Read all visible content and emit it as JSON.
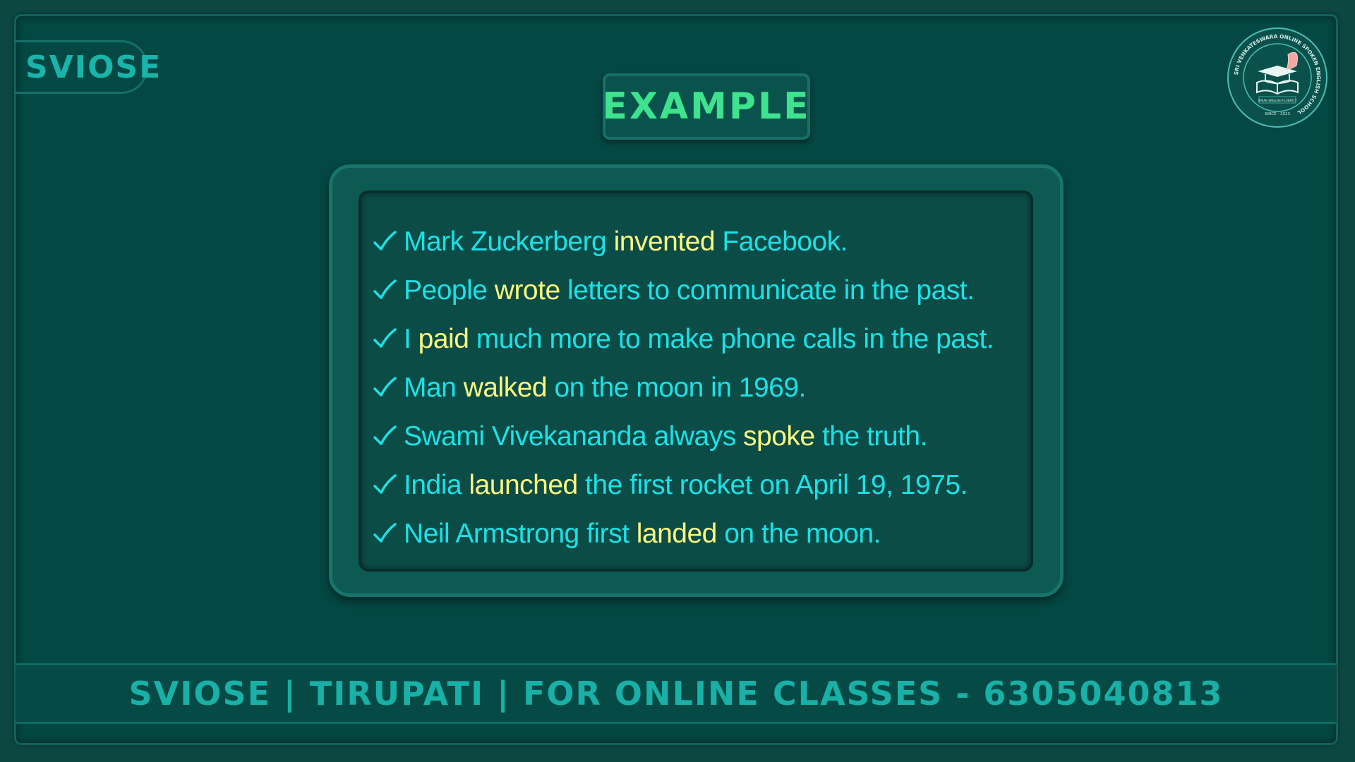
{
  "brand": {
    "tag": "SVIOSE"
  },
  "title": "EXAMPLE",
  "logo": {
    "ring_text": "SRI VENKATESWARA ONLINE SPOKEN ENGLISH SCHOOL",
    "motto": "SPEAK ENGLISH FLUENTLY",
    "since": "SINCE - 2023",
    "icon": "book-quill-cap-icon"
  },
  "examples": [
    {
      "before": "Mark Zuckerberg ",
      "verb": "invented",
      "after": " Facebook."
    },
    {
      "before": "People ",
      "verb": "wrote",
      "after": " letters to communicate in the past."
    },
    {
      "before": "I ",
      "verb": "paid",
      "after": " much more to make phone calls in the past."
    },
    {
      "before": "Man ",
      "verb": "walked",
      "after": " on the moon in 1969."
    },
    {
      "before": "Swami Vivekananda always ",
      "verb": "spoke",
      "after": " the truth."
    },
    {
      "before": "India ",
      "verb": "launched",
      "after": " the first rocket on April 19, 1975."
    },
    {
      "before": "Neil Armstrong first ",
      "verb": "landed",
      "after": " on the moon."
    }
  ],
  "footer": "SVIOSE | TIRUPATI | FOR ONLINE CLASSES - 6305040813",
  "colors": {
    "background": "#044843",
    "text": "#1ce1e6",
    "highlight": "#fbf87f",
    "title": "#3de38d",
    "brand": "#19b5aa"
  }
}
